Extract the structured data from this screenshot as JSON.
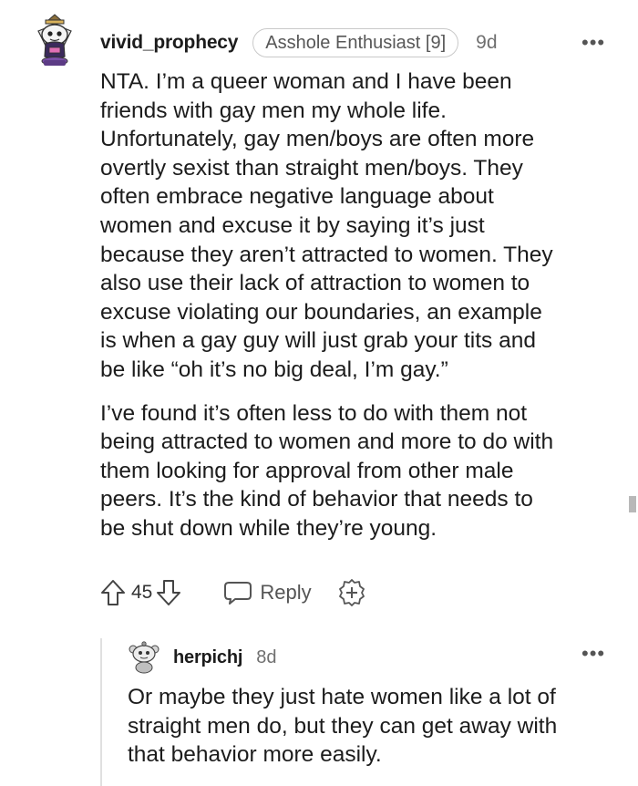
{
  "comment": {
    "username": "vivid_prophecy",
    "flair": "Asshole Enthusiast [9]",
    "age": "9d",
    "more_label": "•••",
    "paragraphs": [
      "NTA. I’m a queer woman and I have been\nfriends with gay men my whole life.\nUnfortunately, gay men/boys are often more\novertly sexist than straight men/boys. They\noften embrace negative language about\nwomen and excuse it by saying it’s just\nbecause they aren’t attracted to women. They\nalso use their lack of attraction to women to\nexcuse violating our boundaries, an example\nis when a gay guy will just grab your tits and\nbe like “oh it’s no big deal, I’m gay.”",
      "I’ve found it’s often less to do with them not\nbeing attracted to women and more to do with\nthem looking for approval from other male\npeers. It’s the kind of behavior that needs to\nbe shut down while they’re young."
    ],
    "actions": {
      "vote_count": "45",
      "reply_label": "Reply"
    }
  },
  "reply": {
    "username": "herpichj",
    "age": "8d",
    "more_label": "•••",
    "text": "Or maybe they just hate women like a lot of\nstraight men do, but they can get away with\nthat behavior more easily."
  },
  "icons": {
    "upvote": "arrow-up-outline",
    "downvote": "arrow-down-outline",
    "reply": "speech-bubble-outline",
    "award": "plus-badge-outline",
    "more": "horizontal-dots"
  }
}
